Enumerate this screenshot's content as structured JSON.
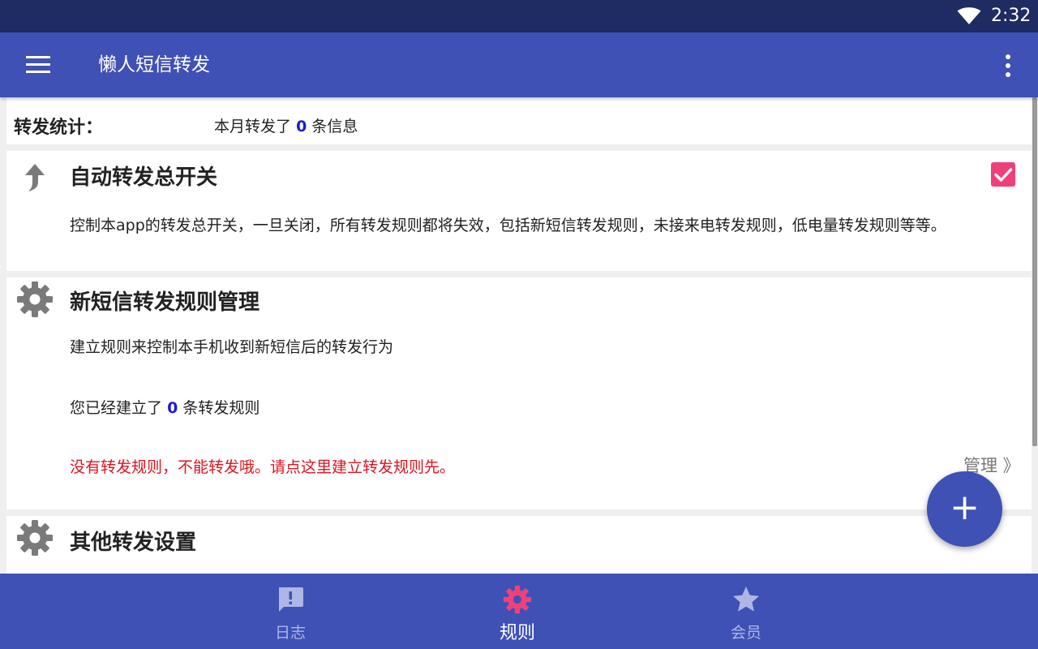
{
  "status_bar": {
    "time": "2:32",
    "wifi_icon": "wifi-icon"
  },
  "app_bar": {
    "title": "懒人短信转发",
    "menu_icon": "menu-icon",
    "more_icon": "more-vert-icon"
  },
  "stats": {
    "label": "转发统计：",
    "prefix": "本月转发了",
    "count": "0",
    "suffix": "条信息"
  },
  "auto_forward": {
    "title": "自动转发总开关",
    "description": "控制本app的转发总开关，一旦关闭，所有转发规则都将失效，包括新短信转发规则，未接来电转发规则，低电量转发规则等等。",
    "checked": true,
    "icon": "forward-arrow-icon"
  },
  "sms_rules": {
    "title": "新短信转发规则管理",
    "description": "建立规则来控制本手机收到新短信后的转发行为",
    "count_prefix": "您已经建立了",
    "count": "0",
    "count_suffix": "条转发规则",
    "warning": "没有转发规则，不能转发哦。请点这里建立转发规则先。",
    "manage_label": "管理 》",
    "icon": "gear-icon"
  },
  "other_settings": {
    "title": "其他转发设置",
    "icon": "gear-icon"
  },
  "fab": {
    "label": "+"
  },
  "bottom_nav": {
    "items": [
      {
        "label": "日志",
        "icon": "message-alert-icon",
        "active": false
      },
      {
        "label": "规则",
        "icon": "gear-icon",
        "active": true
      },
      {
        "label": "会员",
        "icon": "star-icon",
        "active": false
      }
    ]
  },
  "colors": {
    "primary": "#3f51b5",
    "status_bar": "#1f2b63",
    "accent": "#f0407a",
    "count_blue": "#1a1ad6",
    "warning_red": "#e0141e"
  }
}
